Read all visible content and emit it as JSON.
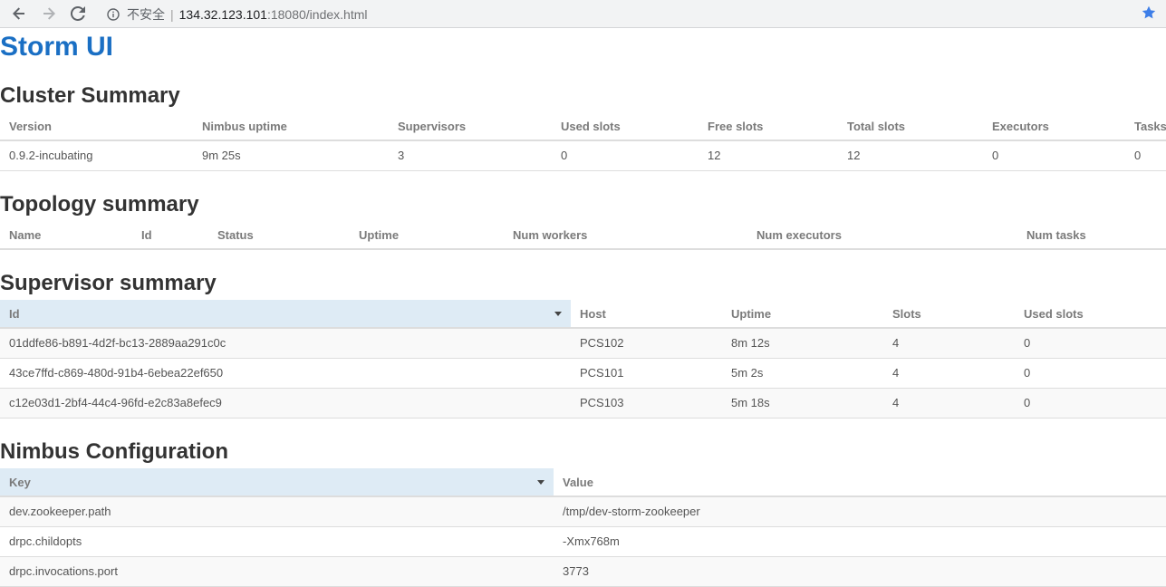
{
  "browser": {
    "insecure_label": "不安全",
    "separator": "|",
    "url_host": "134.32.123.101",
    "url_rest": ":18080/index.html"
  },
  "page_title": "Storm UI",
  "cluster_summary": {
    "heading": "Cluster Summary",
    "columns": [
      "Version",
      "Nimbus uptime",
      "Supervisors",
      "Used slots",
      "Free slots",
      "Total slots",
      "Executors",
      "Tasks"
    ],
    "row": [
      "0.9.2-incubating",
      "9m 25s",
      "3",
      "0",
      "12",
      "12",
      "0",
      "0"
    ]
  },
  "topology_summary": {
    "heading": "Topology summary",
    "columns": [
      "Name",
      "Id",
      "Status",
      "Uptime",
      "Num workers",
      "Num executors",
      "Num tasks"
    ]
  },
  "supervisor_summary": {
    "heading": "Supervisor summary",
    "columns": [
      "Id",
      "Host",
      "Uptime",
      "Slots",
      "Used slots"
    ],
    "rows": [
      [
        "01ddfe86-b891-4d2f-bc13-2889aa291c0c",
        "PCS102",
        "8m 12s",
        "4",
        "0"
      ],
      [
        "43ce7ffd-c869-480d-91b4-6ebea22ef650",
        "PCS101",
        "5m 2s",
        "4",
        "0"
      ],
      [
        "c12e03d1-2bf4-44c4-96fd-e2c83a8efec9",
        "PCS103",
        "5m 18s",
        "4",
        "0"
      ]
    ]
  },
  "nimbus_configuration": {
    "heading": "Nimbus Configuration",
    "columns": [
      "Key",
      "Value"
    ],
    "rows": [
      [
        "dev.zookeeper.path",
        "/tmp/dev-storm-zookeeper"
      ],
      [
        "drpc.childopts",
        "-Xmx768m"
      ],
      [
        "drpc.invocations.port",
        "3773"
      ]
    ]
  },
  "colors": {
    "title_blue": "#1a6fc4",
    "sorted_header_bg": "#deebf5",
    "star_blue": "#3d7ee8"
  }
}
